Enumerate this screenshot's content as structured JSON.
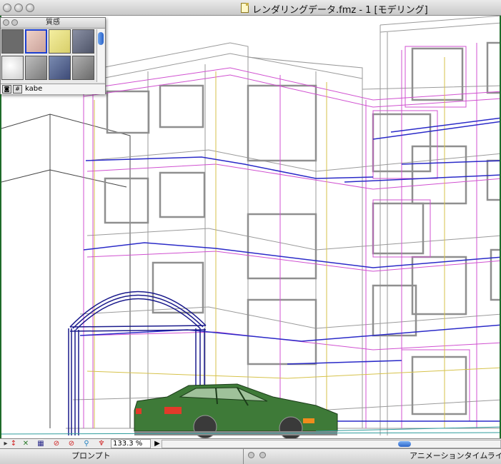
{
  "window": {
    "title": "レンダリングデータ.fmz - 1 [モデリング]"
  },
  "material_palette": {
    "title": "質感",
    "selected_material": "kabe",
    "swatch_colors": [
      "#6b6b6b",
      "#d8b0a8",
      "#e8e28a",
      "#6e7488",
      "#f6f6f6",
      "#9a9a9a",
      "#5a6a90",
      "#8a8a8a"
    ]
  },
  "toolbar": {
    "zoom": "133.3 %"
  },
  "panels": {
    "prompt": "プロンプト",
    "animation_timeline": "アニメーションタイムライ"
  },
  "colors": {
    "accent": "#2b64c8",
    "window_frame": "#1e6b2a",
    "car_body": "#3e7a38",
    "wire_magenta": "#d050d0",
    "wire_blue": "#2020c0",
    "wire_gray": "#9a9a9a"
  }
}
